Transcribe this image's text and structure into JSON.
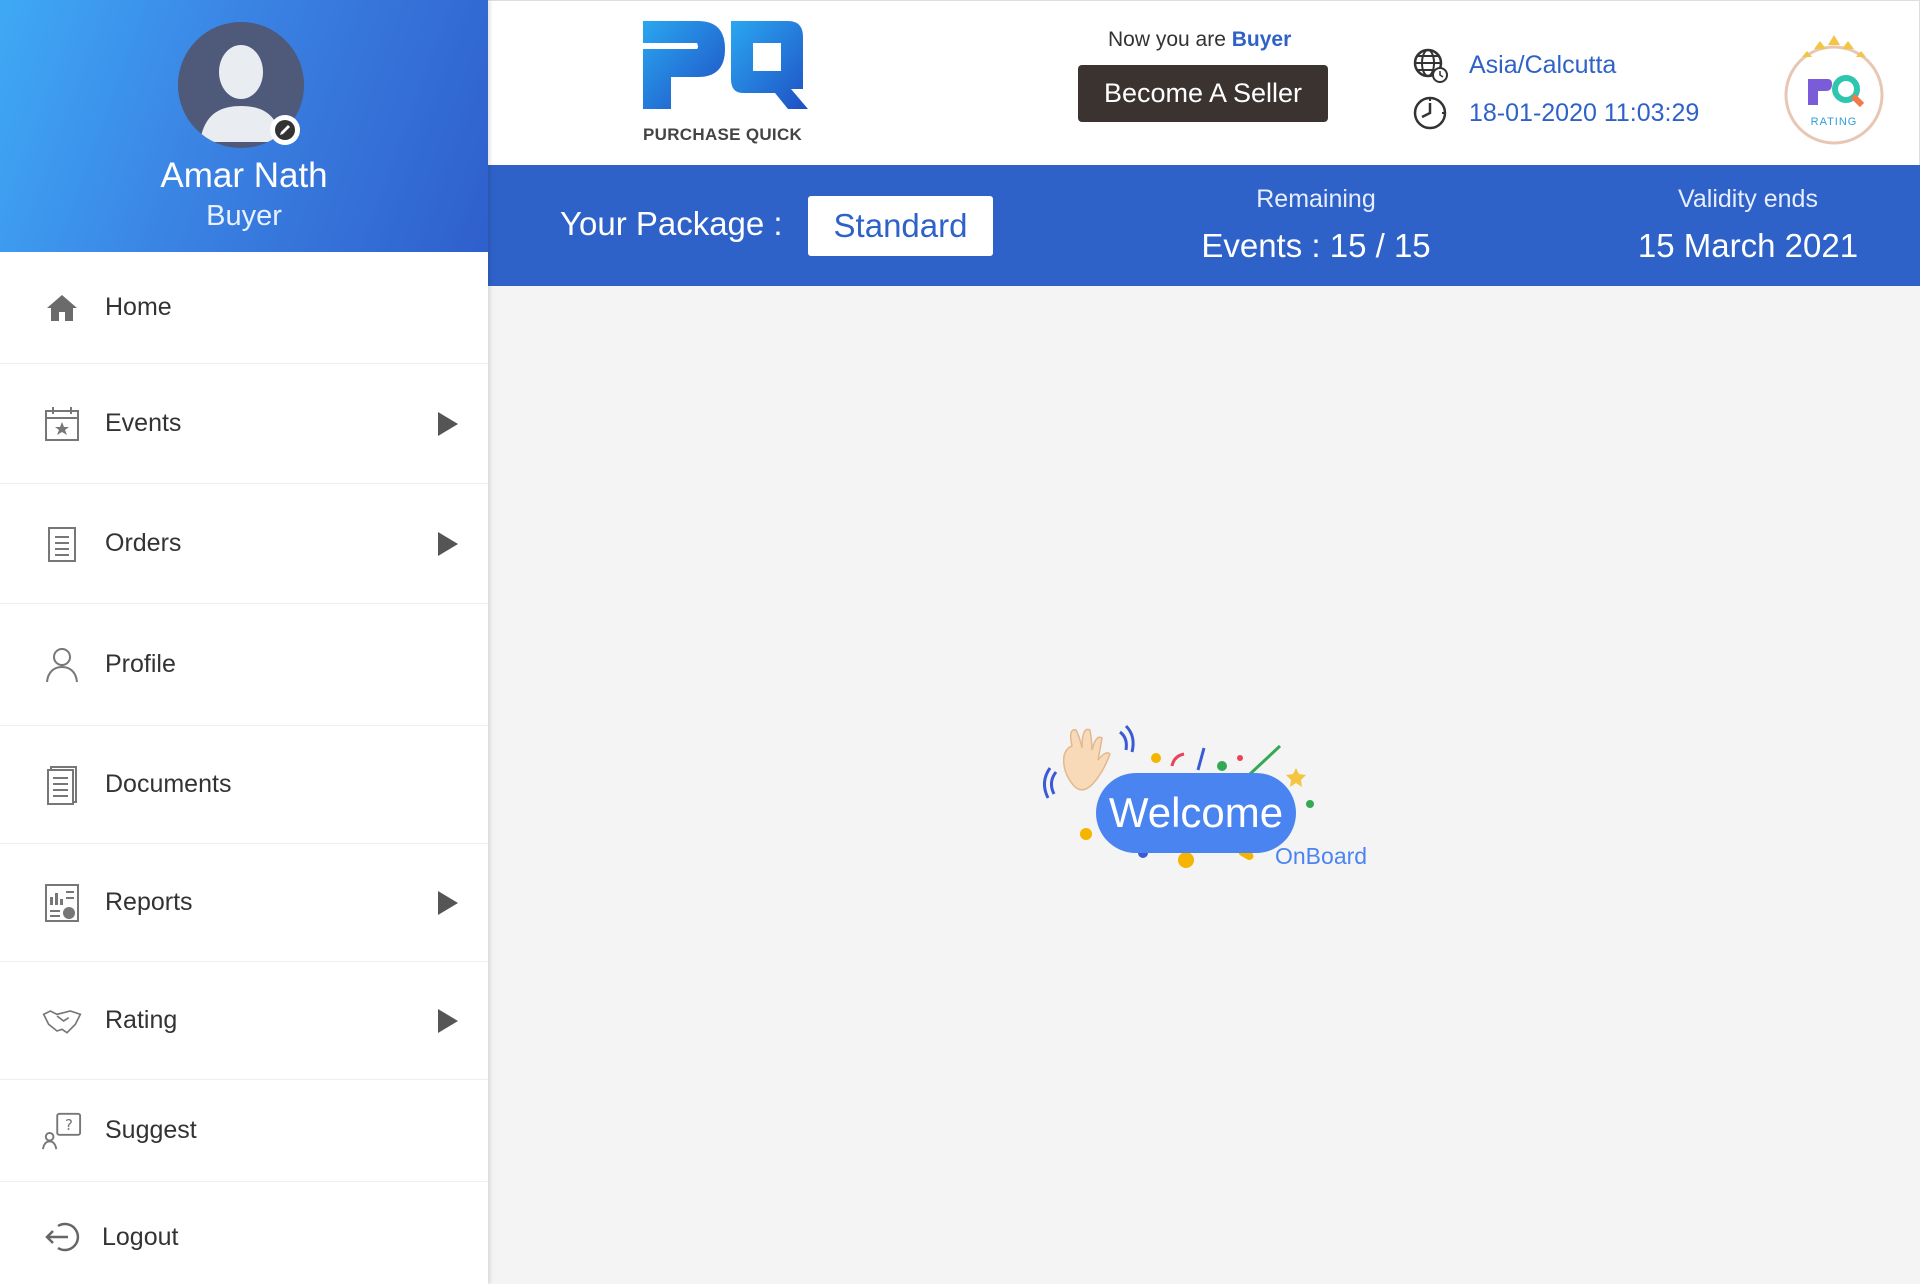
{
  "user": {
    "name": "Amar Nath",
    "role": "Buyer"
  },
  "sidebar": {
    "items": [
      {
        "label": "Home",
        "icon": "home-icon",
        "has_submenu": false
      },
      {
        "label": "Events",
        "icon": "calendar-star-icon",
        "has_submenu": true
      },
      {
        "label": "Orders",
        "icon": "clipboard-list-icon",
        "has_submenu": true
      },
      {
        "label": "Profile",
        "icon": "person-icon",
        "has_submenu": false
      },
      {
        "label": "Documents",
        "icon": "document-icon",
        "has_submenu": false
      },
      {
        "label": "Reports",
        "icon": "report-icon",
        "has_submenu": true
      },
      {
        "label": "Rating",
        "icon": "handshake-icon",
        "has_submenu": true
      },
      {
        "label": "Suggest",
        "icon": "suggest-question-icon",
        "has_submenu": false
      },
      {
        "label": "Logout",
        "icon": "logout-icon",
        "has_submenu": false
      }
    ]
  },
  "header": {
    "logo_text": "PURCHASE QUICK",
    "mode_prefix": "Now you are",
    "mode_role": "Buyer",
    "become_seller_label": "Become A Seller",
    "timezone": "Asia/Calcutta",
    "datetime": "18-01-2020 11:03:29",
    "rating_badge_text": "RATING"
  },
  "package": {
    "label": "Your Package :",
    "value": "Standard",
    "remaining_title": "Remaining",
    "remaining_value": "Events : 15 / 15",
    "validity_title": "Validity ends",
    "validity_value": "15 March 2021"
  },
  "welcome": {
    "title": "Welcome",
    "subtitle": "OnBoard"
  },
  "colors": {
    "primary": "#2f62c8",
    "button_dark": "#3a3330",
    "welcome_blue": "#4a84f0"
  }
}
